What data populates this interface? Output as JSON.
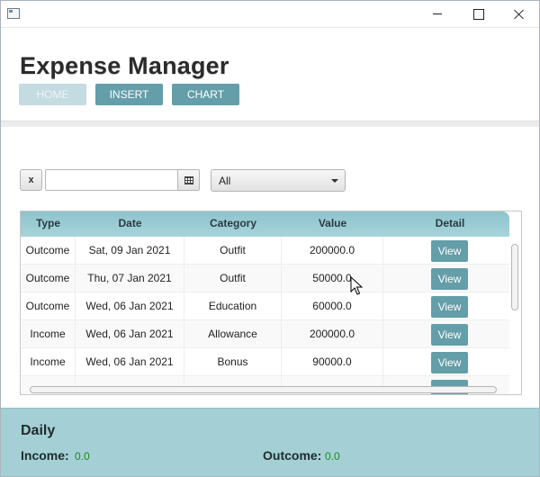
{
  "header": {
    "title": "Expense Manager",
    "nav": [
      {
        "label": "HOME",
        "active": true
      },
      {
        "label": "INSERT",
        "active": false
      },
      {
        "label": "CHART",
        "active": false
      }
    ]
  },
  "filters": {
    "clear_label": "x",
    "date_value": "",
    "type_select": {
      "selected": "All"
    }
  },
  "table": {
    "columns": [
      "Type",
      "Date",
      "Category",
      "Value",
      "Detail"
    ],
    "rows": [
      {
        "type": "Outcome",
        "date": "Sat, 09 Jan 2021",
        "category": "Outfit",
        "value": "200000.0",
        "detail": "View"
      },
      {
        "type": "Outcome",
        "date": "Thu, 07 Jan 2021",
        "category": "Outfit",
        "value": "50000.0",
        "detail": "View"
      },
      {
        "type": "Outcome",
        "date": "Wed, 06 Jan 2021",
        "category": "Education",
        "value": "60000.0",
        "detail": "View"
      },
      {
        "type": "Income",
        "date": "Wed, 06 Jan 2021",
        "category": "Allowance",
        "value": "200000.0",
        "detail": "View"
      },
      {
        "type": "Income",
        "date": "Wed, 06 Jan 2021",
        "category": "Bonus",
        "value": "90000.0",
        "detail": "View"
      }
    ]
  },
  "footer": {
    "title": "Daily",
    "income_label": "Income:",
    "income_value": "0.0",
    "outcome_label": "Outcome:",
    "outcome_value": "0.0"
  },
  "colors": {
    "accent": "#649ea8",
    "header_row": "#a6d4db",
    "footer_bg": "#a4d0d5",
    "positive_value": "#1c8a1c"
  }
}
